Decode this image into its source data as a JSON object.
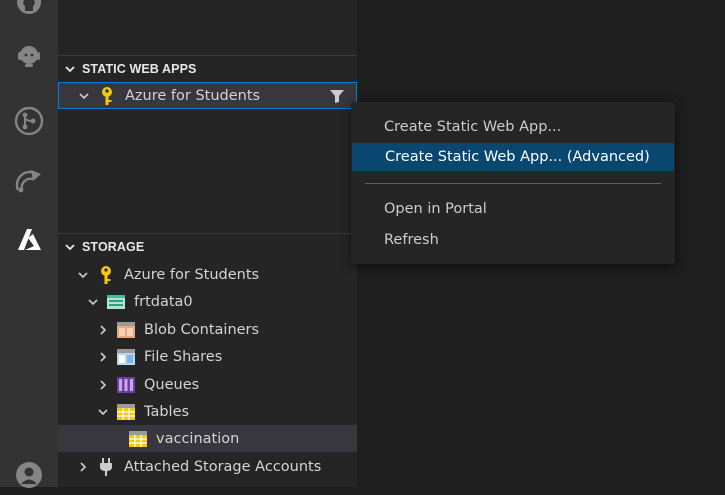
{
  "activity_bar": {
    "icons": [
      "github-icon",
      "live-share-icon",
      "source-control-icon",
      "remote-explorer-icon",
      "azure-icon",
      "account-icon"
    ]
  },
  "static_web_apps": {
    "header": "STATIC WEB APPS",
    "subscription": "Azure for Students"
  },
  "storage": {
    "header": "STORAGE",
    "subscription": "Azure for Students",
    "account": "frtdata0",
    "items": {
      "blob": "Blob Containers",
      "files": "File Shares",
      "queues": "Queues",
      "tables": "Tables",
      "table_child": "vaccination"
    },
    "attached": "Attached Storage Accounts"
  },
  "context_menu": {
    "items": [
      "Create Static Web App...",
      "Create Static Web App... (Advanced)",
      "Open in Portal",
      "Refresh"
    ],
    "active_index": 1
  },
  "colors": {
    "activity_bg": "#333333",
    "sidebar_bg": "#252526",
    "editor_bg": "#1e1e1e",
    "focus_border": "#007fd4",
    "menu_active": "#094771",
    "key_gold": "#f2c811"
  }
}
